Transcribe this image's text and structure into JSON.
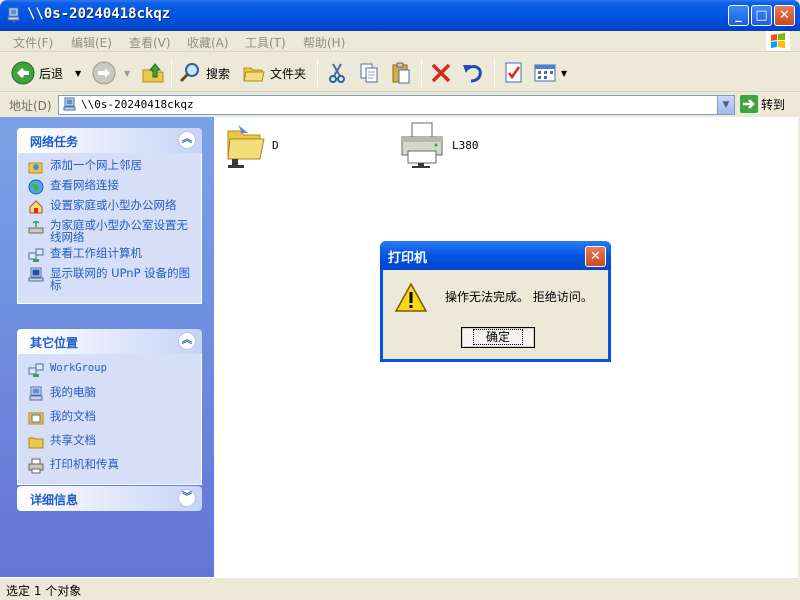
{
  "window": {
    "title": "\\\\0s-20240418ckqz"
  },
  "menu": [
    "文件(F)",
    "编辑(E)",
    "查看(V)",
    "收藏(A)",
    "工具(T)",
    "帮助(H)"
  ],
  "toolbar": {
    "back": "后退",
    "search": "搜索",
    "folders": "文件夹"
  },
  "address": {
    "label": "地址(D)",
    "value": "\\\\0s-20240418ckqz",
    "go": "转到"
  },
  "panels": {
    "network_tasks": {
      "title": "网络任务",
      "items": [
        "添加一个网上邻居",
        "查看网络连接",
        "设置家庭或小型办公网络",
        "为家庭或小型办公室设置无线网络",
        "查看工作组计算机",
        "显示联网的 UPnP 设备的图标"
      ]
    },
    "other_places": {
      "title": "其它位置",
      "items": [
        "WorkGroup",
        "我的电脑",
        "我的文档",
        "共享文档",
        "打印机和传真"
      ]
    },
    "details": {
      "title": "详细信息"
    }
  },
  "content": {
    "items": [
      {
        "name": "D",
        "icon": "shared-folder-icon"
      },
      {
        "name": "L380",
        "icon": "printer-icon"
      }
    ]
  },
  "status": {
    "text": "选定 1 个对象"
  },
  "dialog": {
    "title": "打印机",
    "message": "操作无法完成。 拒绝访问。",
    "ok": "确定",
    "icon": "warning-icon"
  }
}
